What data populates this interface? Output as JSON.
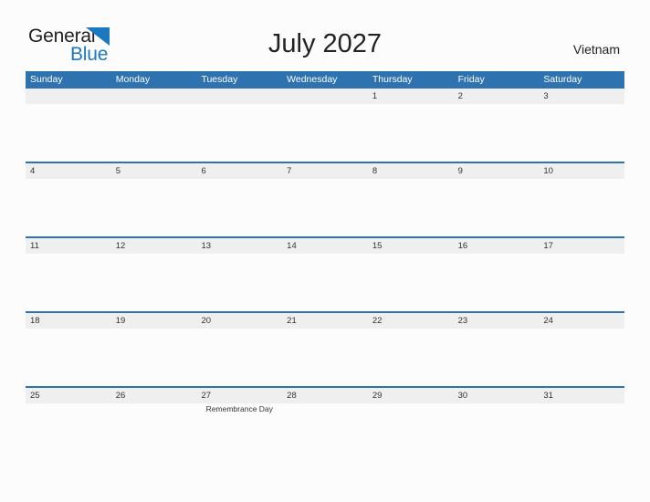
{
  "brand": {
    "name_part1": "General",
    "name_part2": "Blue",
    "flag_icon": "blue-triangle-flag-icon",
    "color_dark": "#231f20",
    "color_blue": "#1c79c0"
  },
  "header": {
    "title": "July 2027",
    "region": "Vietnam"
  },
  "theme": {
    "header_blue": "#2e72b0",
    "row_gray": "#efefef",
    "page_background": "#fcfcfc",
    "text_dark": "#333333"
  },
  "calendar": {
    "month": "July",
    "year": "2027",
    "weekday_headers": [
      "Sunday",
      "Monday",
      "Tuesday",
      "Wednesday",
      "Thursday",
      "Friday",
      "Saturday"
    ],
    "weeks": [
      {
        "days": [
          {
            "number": "",
            "event": ""
          },
          {
            "number": "",
            "event": ""
          },
          {
            "number": "",
            "event": ""
          },
          {
            "number": "",
            "event": ""
          },
          {
            "number": "1",
            "event": ""
          },
          {
            "number": "2",
            "event": ""
          },
          {
            "number": "3",
            "event": ""
          }
        ]
      },
      {
        "days": [
          {
            "number": "4",
            "event": ""
          },
          {
            "number": "5",
            "event": ""
          },
          {
            "number": "6",
            "event": ""
          },
          {
            "number": "7",
            "event": ""
          },
          {
            "number": "8",
            "event": ""
          },
          {
            "number": "9",
            "event": ""
          },
          {
            "number": "10",
            "event": ""
          }
        ]
      },
      {
        "days": [
          {
            "number": "11",
            "event": ""
          },
          {
            "number": "12",
            "event": ""
          },
          {
            "number": "13",
            "event": ""
          },
          {
            "number": "14",
            "event": ""
          },
          {
            "number": "15",
            "event": ""
          },
          {
            "number": "16",
            "event": ""
          },
          {
            "number": "17",
            "event": ""
          }
        ]
      },
      {
        "days": [
          {
            "number": "18",
            "event": ""
          },
          {
            "number": "19",
            "event": ""
          },
          {
            "number": "20",
            "event": ""
          },
          {
            "number": "21",
            "event": ""
          },
          {
            "number": "22",
            "event": ""
          },
          {
            "number": "23",
            "event": ""
          },
          {
            "number": "24",
            "event": ""
          }
        ]
      },
      {
        "days": [
          {
            "number": "25",
            "event": ""
          },
          {
            "number": "26",
            "event": ""
          },
          {
            "number": "27",
            "event": "Remembrance Day"
          },
          {
            "number": "28",
            "event": ""
          },
          {
            "number": "29",
            "event": ""
          },
          {
            "number": "30",
            "event": ""
          },
          {
            "number": "31",
            "event": ""
          }
        ]
      }
    ]
  }
}
